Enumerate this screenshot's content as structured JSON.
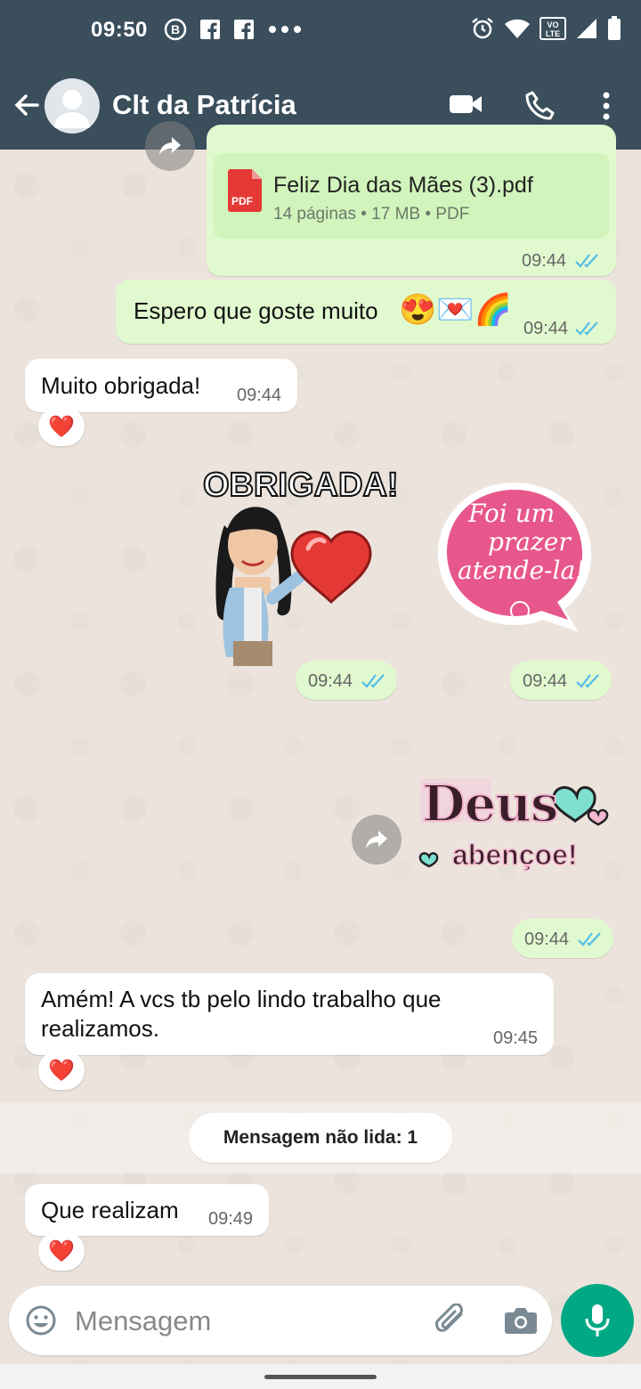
{
  "status_bar": {
    "time": "09:50",
    "left_icons": [
      "b-circle-icon",
      "facebook-icon",
      "facebook-icon",
      "more-dots-icon"
    ],
    "right_icons": [
      "alarm-icon",
      "wifi-icon",
      "volte-icon",
      "signal-icon",
      "battery-icon"
    ],
    "volte_label": "VO LTE"
  },
  "header": {
    "title": "Clt da Patrícia"
  },
  "messages": {
    "pdf": {
      "filename": "Feliz Dia das Mães (3).pdf",
      "meta": "14 páginas • 17 MB • PDF",
      "badge": "PDF",
      "time": "09:44"
    },
    "m2": {
      "text": "Espero que goste muito",
      "emojis": "😍💌🌈",
      "time": "09:44"
    },
    "m3": {
      "text": "Muito obrigada!",
      "time": "09:44",
      "reaction": "❤️"
    },
    "sticker1": {
      "caption": "OBRIGADA!",
      "time": "09:44"
    },
    "sticker2": {
      "line1": "Foi um",
      "line2": "prazer",
      "line3": "atende-la!",
      "time": "09:44"
    },
    "sticker3": {
      "line1": "Deus",
      "line2": "abençoe!",
      "time": "09:44"
    },
    "m4": {
      "text": "Amém! A vcs tb pelo lindo trabalho que realizamos.",
      "time": "09:45",
      "reaction": "❤️"
    },
    "unread_label": "Mensagem não lida: 1",
    "m5": {
      "text": "Que realizam",
      "time": "09:49",
      "reaction": "❤️"
    }
  },
  "composer": {
    "placeholder": "Mensagem"
  },
  "colors": {
    "header": "#3a4e5c",
    "outgoing": "#e1f9cf",
    "accent": "#00a884",
    "ticks": "#53bdeb"
  }
}
